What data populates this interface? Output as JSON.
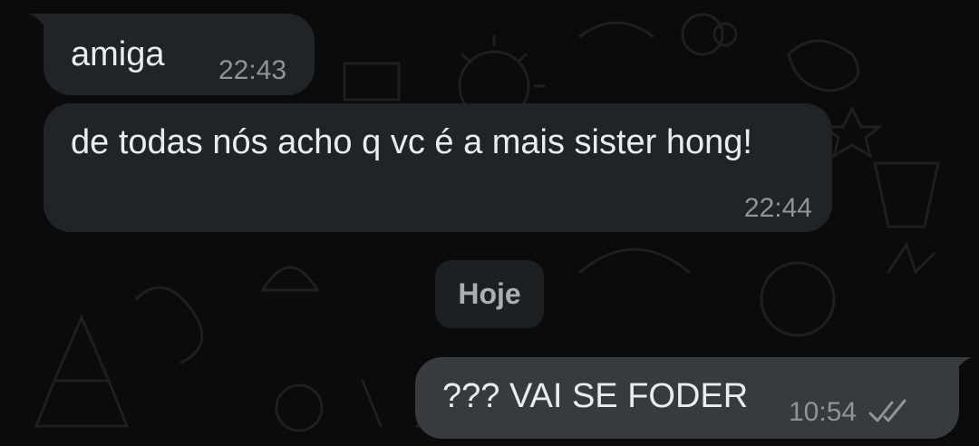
{
  "messages": [
    {
      "text": "amiga",
      "time": "22:43",
      "direction": "incoming"
    },
    {
      "text": "de todas nós acho q vc é a mais sister hong!",
      "time": "22:44",
      "direction": "incoming"
    },
    {
      "text": "??? VAI SE FODER",
      "time": "10:54",
      "direction": "outgoing",
      "status_icon": "double-check-icon"
    }
  ],
  "date_separator": "Hoje",
  "colors": {
    "background": "#0b0b0b",
    "incoming_bubble": "#202427",
    "outgoing_bubble": "#383b3e",
    "text": "#e9edef",
    "timestamp": "#8d9599"
  }
}
